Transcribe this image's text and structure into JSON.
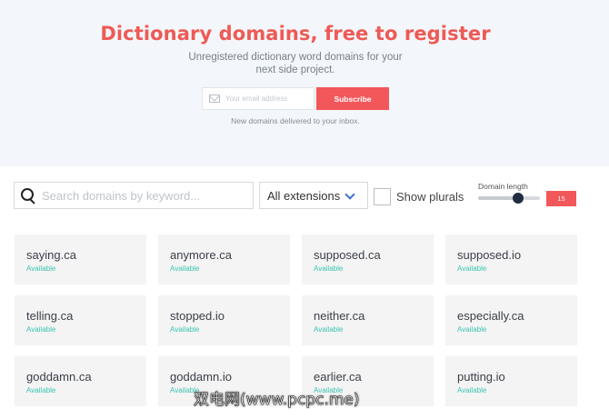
{
  "hero": {
    "title": "Dictionary domains, free to register",
    "subtitle": "Unregistered dictionary word domains for your next side project.",
    "email_placeholder": "Your email address",
    "subscribe_label": "Subscribe",
    "note": "New domains delivered to your inbox."
  },
  "colors": {
    "accent": "#f2575a",
    "available": "#3cc5ac",
    "slider_thumb": "#202c3f"
  },
  "filters": {
    "search_placeholder": "Search domains by keyword...",
    "extension_selected": "All extensions",
    "show_plurals_label": "Show plurals",
    "show_plurals_checked": false,
    "domain_length_label": "Domain length",
    "domain_length_value": "15",
    "domain_length_position": 0.64
  },
  "domains": [
    {
      "name": "saying.ca",
      "status": "Available"
    },
    {
      "name": "anymore.ca",
      "status": "Available"
    },
    {
      "name": "supposed.ca",
      "status": "Available"
    },
    {
      "name": "supposed.io",
      "status": "Available"
    },
    {
      "name": "telling.ca",
      "status": "Available"
    },
    {
      "name": "stopped.io",
      "status": "Available"
    },
    {
      "name": "neither.ca",
      "status": "Available"
    },
    {
      "name": "especially.ca",
      "status": "Available"
    },
    {
      "name": "goddamn.ca",
      "status": "Available"
    },
    {
      "name": "goddamn.io",
      "status": "Available"
    },
    {
      "name": "earlier.ca",
      "status": "Available"
    },
    {
      "name": "putting.io",
      "status": "Available"
    }
  ],
  "watermark": "双电网(www.pcpc.me)"
}
